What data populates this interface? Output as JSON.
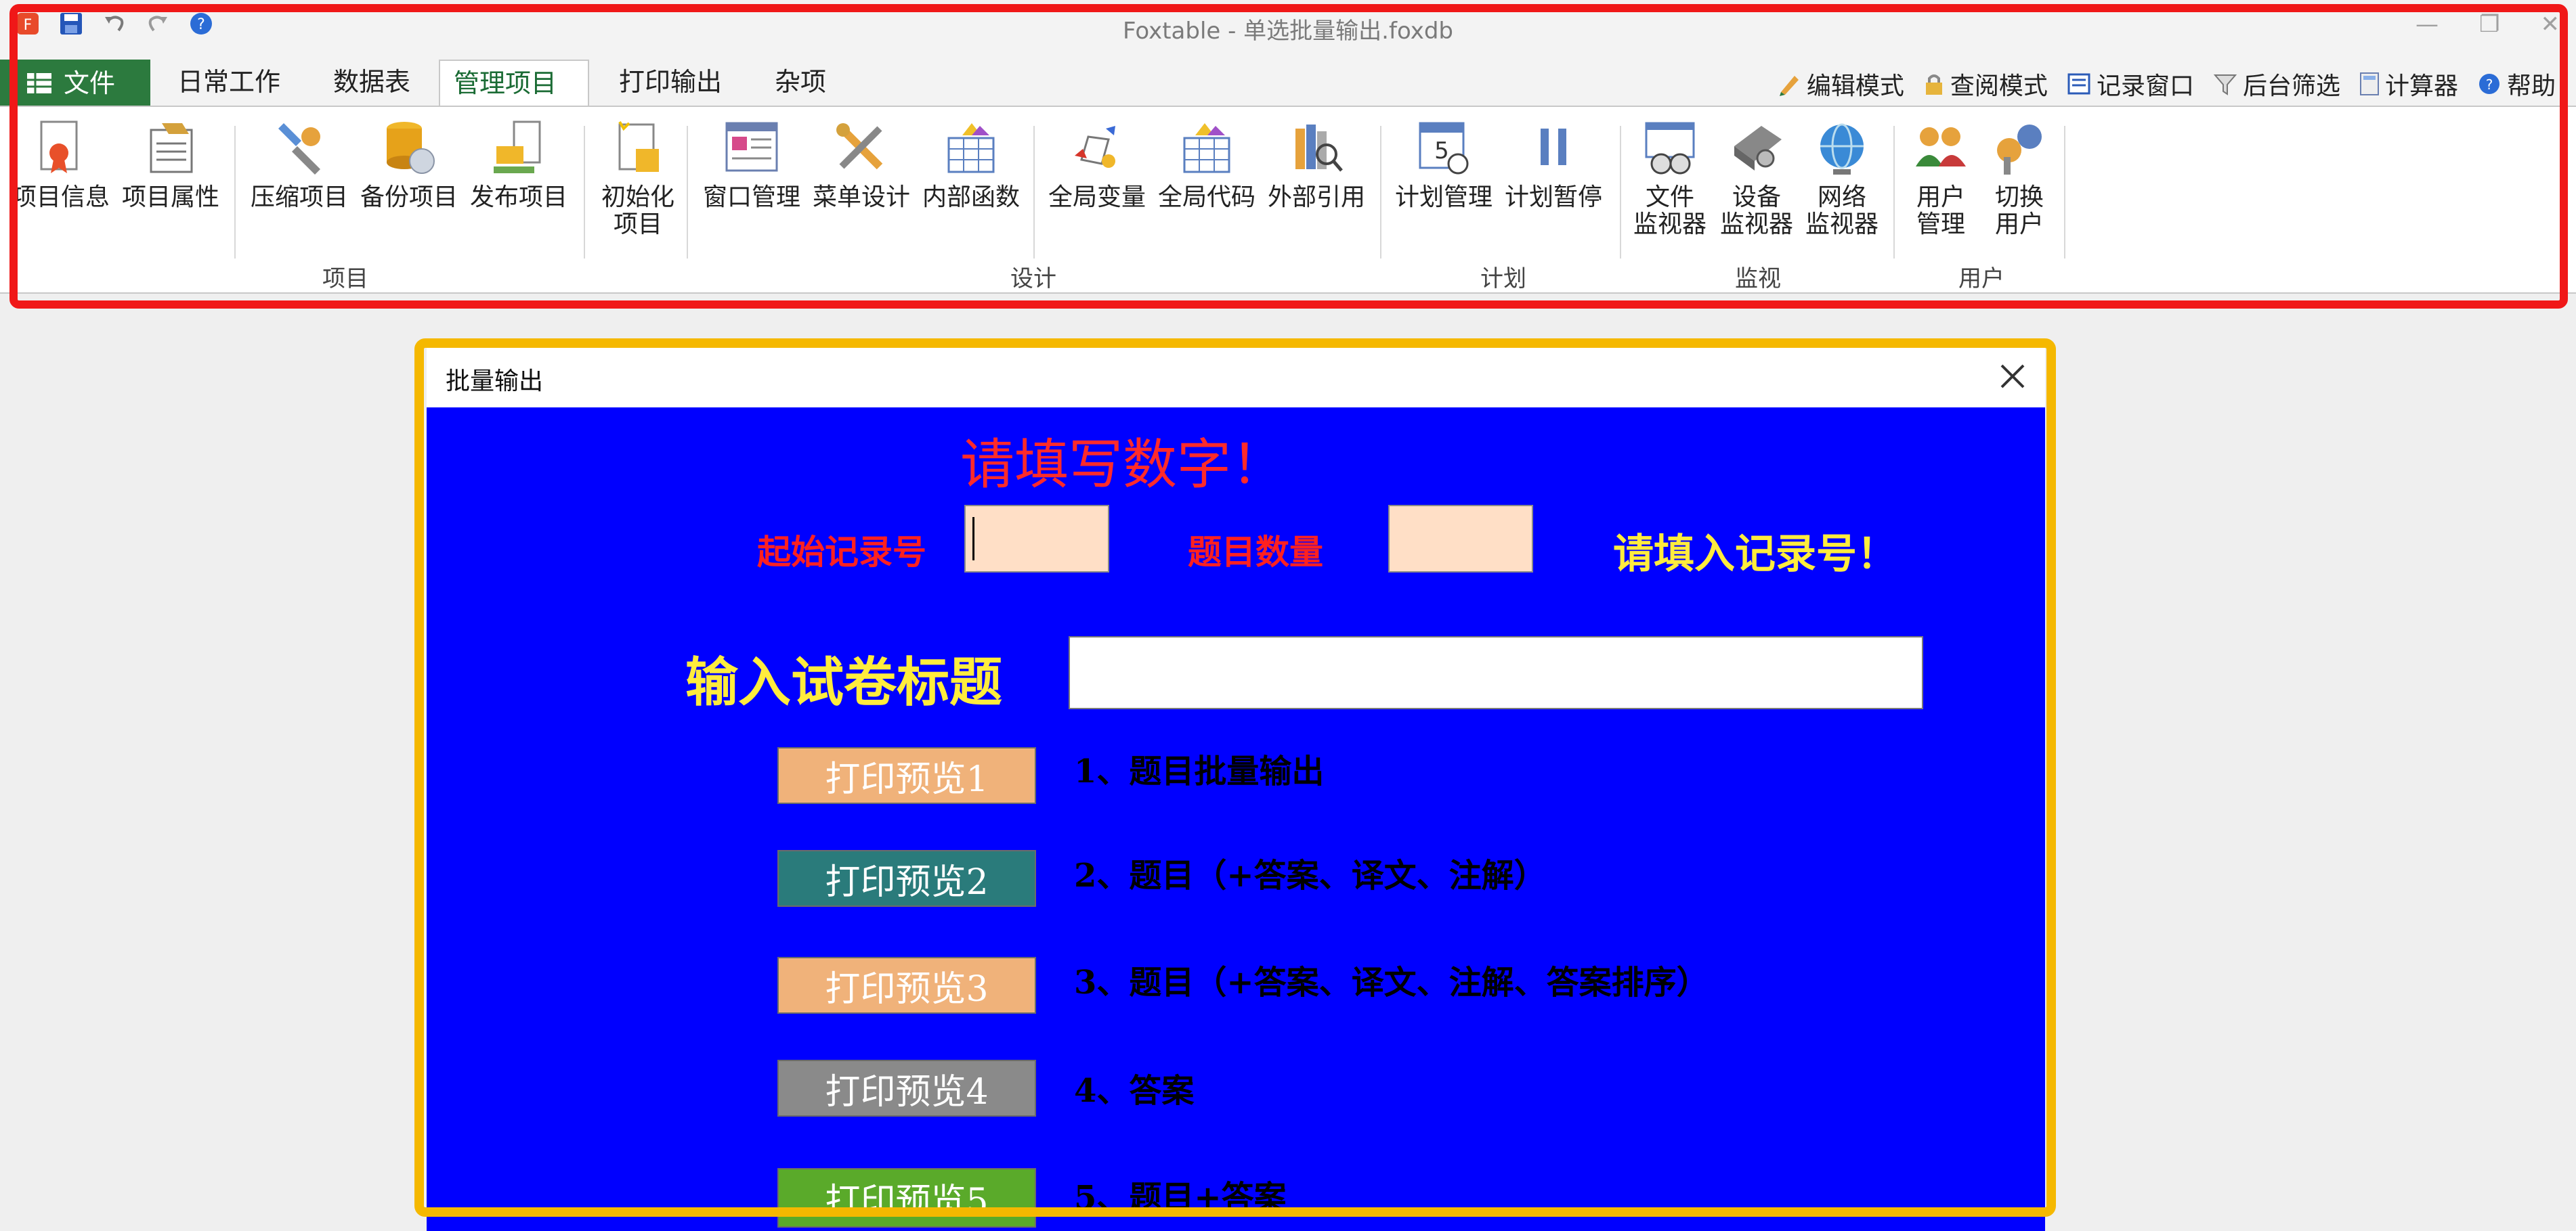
{
  "window": {
    "title": "Foxtable - 单选批量输出.foxdb"
  },
  "ribbon_tabs": [
    {
      "label": "文件"
    },
    {
      "label": "日常工作"
    },
    {
      "label": "数据表"
    },
    {
      "label": "管理项目"
    },
    {
      "label": "打印输出"
    },
    {
      "label": "杂项"
    }
  ],
  "tools": [
    {
      "label": "编辑模式",
      "icon": "pencil-icon"
    },
    {
      "label": "查阅模式",
      "icon": "lock-icon"
    },
    {
      "label": "记录窗口",
      "icon": "form-icon"
    },
    {
      "label": "后台筛选",
      "icon": "filter-icon"
    },
    {
      "label": "计算器",
      "icon": "calculator-icon"
    },
    {
      "label": "帮助",
      "icon": "help-icon"
    }
  ],
  "ribbon_buttons": {
    "b1": "项目信息",
    "b2": "项目属性",
    "b3": "压缩项目",
    "b4": "备份项目",
    "b5": "发布项目",
    "b6": "初始化\n项目",
    "b7": "窗口管理",
    "b8": "菜单设计",
    "b9": "内部函数",
    "b10": "全局变量",
    "b11": "全局代码",
    "b12": "外部引用",
    "b13": "计划管理",
    "b14": "计划暂停",
    "b15": "文件\n监视器",
    "b16": "设备\n监视器",
    "b17": "网络\n监视器",
    "b18": "用户\n管理",
    "b19": "切换\n用户"
  },
  "groups": {
    "g1": "项目",
    "g2": "设计",
    "g3": "计划",
    "g4": "监视",
    "g5": "用户"
  },
  "dialog": {
    "title": "批量输出",
    "warn_top": "请填写数字！",
    "start_label": "起始记录号",
    "count_label": "题目数量",
    "warn_right": "请填入记录号！",
    "title_label": "输入试卷标题",
    "buttons": [
      {
        "label": "打印预览1",
        "desc": "1、题目批量输出",
        "color": "#f0b27a"
      },
      {
        "label": "打印预览2",
        "desc": "2、题目（+答案、译文、注解）",
        "color": "#2a7b7b"
      },
      {
        "label": "打印预览3",
        "desc": "3、题目（+答案、译文、注解、答案排序）",
        "color": "#f0b27a"
      },
      {
        "label": "打印预览4",
        "desc": "4、答案",
        "color": "#8a8a8a"
      },
      {
        "label": "打印预览5",
        "desc": "5、题目+答案",
        "color": "#5aaa2a"
      }
    ]
  },
  "colors": {
    "dialog_bg": "#0000ff",
    "accent_red": "#ff2020",
    "accent_yellow": "#ffec3d",
    "ribbon_file": "#2c7a3e"
  }
}
